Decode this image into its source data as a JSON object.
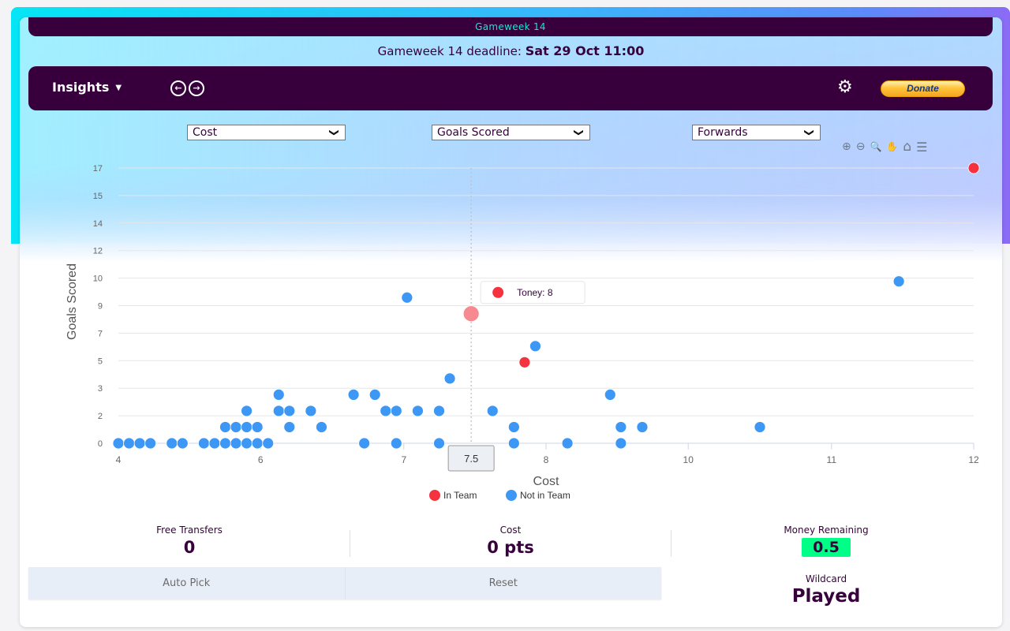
{
  "header": {
    "gameweek_label": "Gameweek 14",
    "deadline_prefix": "Gameweek 14 deadline:",
    "deadline_value": "Sat 29 Oct 11:00"
  },
  "toolbar": {
    "insights_label": "Insights",
    "caret": "▼",
    "prev_icon": "←",
    "next_icon": "→",
    "settings_icon": "⚙",
    "donate_label": "Donate"
  },
  "filters": {
    "x_metric": "Cost",
    "y_metric": "Goals Scored",
    "position": "Forwards",
    "chevron": "❯"
  },
  "chart_tools": {
    "zoom_in": "⊕",
    "zoom_out": "⊖",
    "zoom_select": "🔍",
    "pan": "✋",
    "reset": "⌂",
    "menu": "☰"
  },
  "chart_data": {
    "type": "scatter",
    "title": "",
    "xlabel": "Cost",
    "ylabel": "Goals Scored",
    "xlim": [
      4,
      12
    ],
    "ylim": [
      0,
      17
    ],
    "x_tick_values": [
      4,
      5.33,
      6.67,
      8,
      9.33,
      10.67,
      12
    ],
    "x_tick_labels": [
      "4",
      "6",
      "7",
      "8",
      "10",
      "11",
      "12"
    ],
    "y_tick_values": [
      0,
      1.7,
      3.4,
      5.1,
      6.8,
      8.5,
      10.2,
      11.9,
      13.6,
      15.3,
      17
    ],
    "y_tick_labels": [
      "0",
      "2",
      "3",
      "5",
      "7",
      "9",
      "10",
      "12",
      "14",
      "15",
      "17"
    ],
    "grid": true,
    "legend": {
      "placement": "bottom",
      "entries": [
        {
          "name": "In Team",
          "color": "#f5333f"
        },
        {
          "name": "Not in Team",
          "color": "#3d97f5"
        }
      ]
    },
    "series": [
      {
        "name": "In Team",
        "color": "#f5333f",
        "points": [
          {
            "x": 12.0,
            "y": 17
          },
          {
            "x": 7.3,
            "y": 8,
            "label": "Toney",
            "hovered": true
          },
          {
            "x": 7.8,
            "y": 5
          }
        ]
      },
      {
        "name": "Not in Team",
        "color": "#3d97f5",
        "points": [
          {
            "x": 11.3,
            "y": 10
          },
          {
            "x": 6.7,
            "y": 9
          },
          {
            "x": 7.9,
            "y": 6
          },
          {
            "x": 7.1,
            "y": 4
          },
          {
            "x": 5.5,
            "y": 3
          },
          {
            "x": 6.2,
            "y": 3
          },
          {
            "x": 6.4,
            "y": 3
          },
          {
            "x": 8.6,
            "y": 3
          },
          {
            "x": 5.2,
            "y": 2
          },
          {
            "x": 5.5,
            "y": 2
          },
          {
            "x": 5.6,
            "y": 2
          },
          {
            "x": 5.8,
            "y": 2
          },
          {
            "x": 6.5,
            "y": 2
          },
          {
            "x": 6.6,
            "y": 2
          },
          {
            "x": 6.8,
            "y": 2
          },
          {
            "x": 7.0,
            "y": 2
          },
          {
            "x": 7.5,
            "y": 2
          },
          {
            "x": 5.0,
            "y": 1
          },
          {
            "x": 5.1,
            "y": 1
          },
          {
            "x": 5.2,
            "y": 1
          },
          {
            "x": 5.3,
            "y": 1
          },
          {
            "x": 5.6,
            "y": 1
          },
          {
            "x": 5.9,
            "y": 1
          },
          {
            "x": 7.7,
            "y": 1
          },
          {
            "x": 8.7,
            "y": 1
          },
          {
            "x": 8.9,
            "y": 1
          },
          {
            "x": 10.0,
            "y": 1
          },
          {
            "x": 4.0,
            "y": 0
          },
          {
            "x": 4.1,
            "y": 0
          },
          {
            "x": 4.2,
            "y": 0
          },
          {
            "x": 4.3,
            "y": 0
          },
          {
            "x": 4.5,
            "y": 0
          },
          {
            "x": 4.6,
            "y": 0
          },
          {
            "x": 4.8,
            "y": 0
          },
          {
            "x": 4.9,
            "y": 0
          },
          {
            "x": 5.0,
            "y": 0
          },
          {
            "x": 5.1,
            "y": 0
          },
          {
            "x": 5.2,
            "y": 0
          },
          {
            "x": 5.3,
            "y": 0
          },
          {
            "x": 5.4,
            "y": 0
          },
          {
            "x": 6.3,
            "y": 0
          },
          {
            "x": 6.6,
            "y": 0
          },
          {
            "x": 7.0,
            "y": 0
          },
          {
            "x": 7.7,
            "y": 0
          },
          {
            "x": 8.2,
            "y": 0
          },
          {
            "x": 8.7,
            "y": 0
          }
        ]
      }
    ],
    "tooltip": {
      "name": "Toney",
      "value": "8",
      "color": "#f5333f"
    },
    "crosshair_label": "7.5"
  },
  "stats": {
    "free_transfers_label": "Free Transfers",
    "free_transfers_value": "0",
    "cost_label": "Cost",
    "cost_value": "0 pts",
    "money_label": "Money Remaining",
    "money_value": "0.5",
    "wildcard_label": "Wildcard",
    "wildcard_value": "Played"
  },
  "actions": {
    "auto_pick": "Auto Pick",
    "reset": "Reset"
  }
}
